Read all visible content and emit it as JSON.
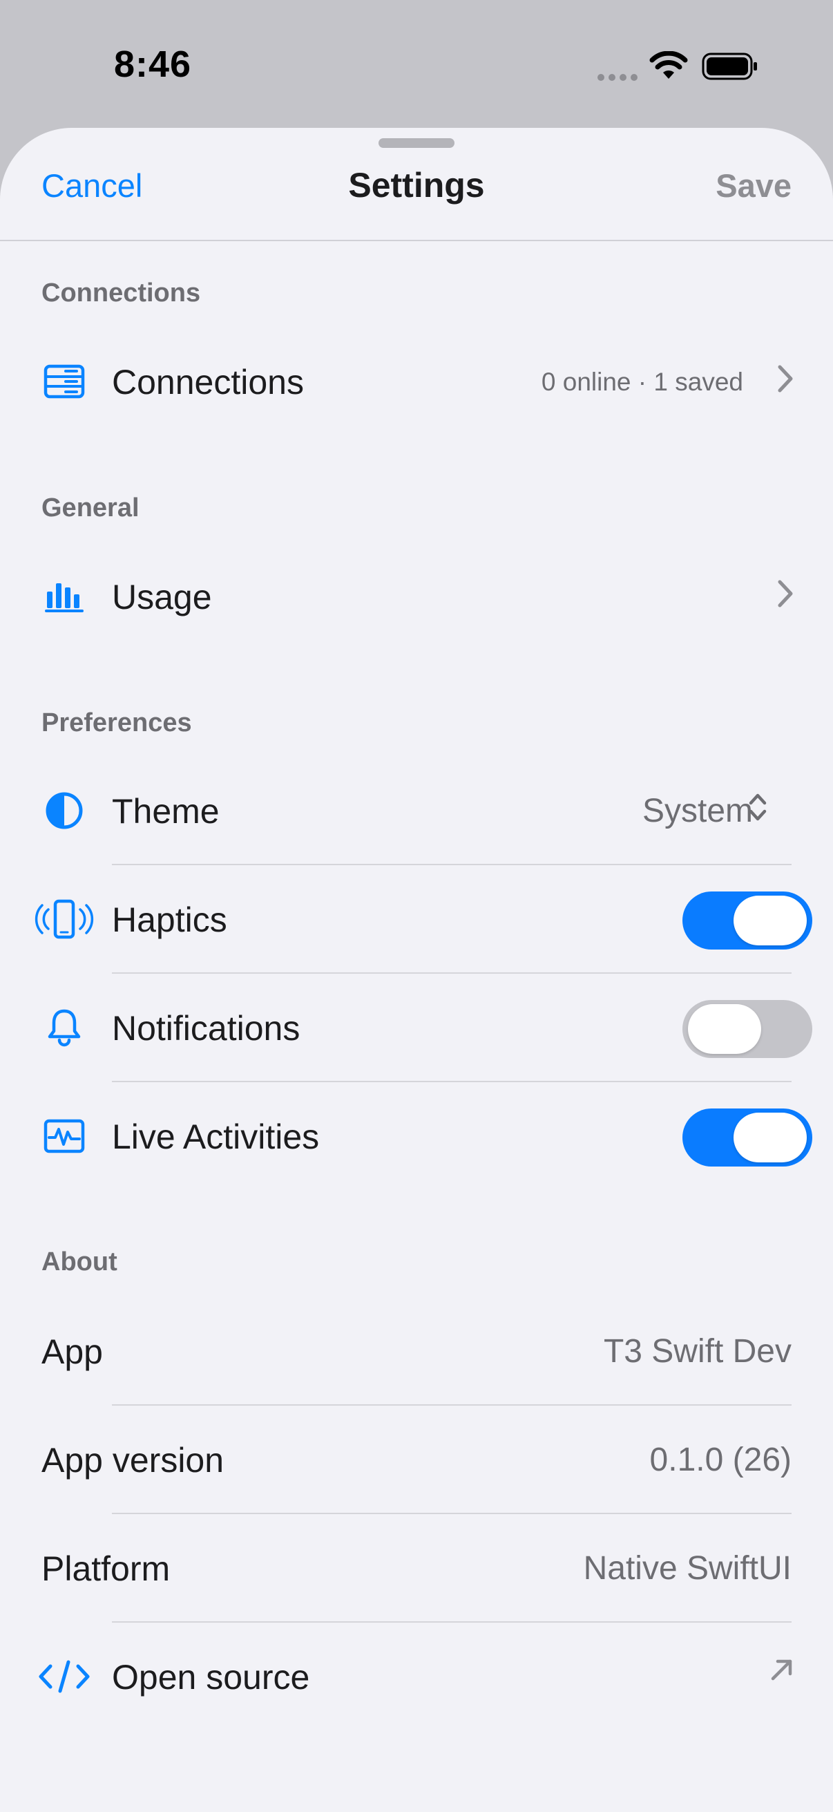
{
  "status_bar": {
    "time": "8:46",
    "icons": [
      "cellular-dots-icon",
      "wifi-icon",
      "battery-icon"
    ]
  },
  "nav": {
    "cancel_label": "Cancel",
    "title": "Settings",
    "save_label": "Save"
  },
  "sections": {
    "connections": {
      "header": "Connections",
      "row": {
        "icon": "server-icon",
        "label": "Connections",
        "detail": "0 online · 1 saved"
      }
    },
    "general": {
      "header": "General",
      "row": {
        "icon": "chart-bar-icon",
        "label": "Usage"
      }
    },
    "preferences": {
      "header": "Preferences",
      "theme": {
        "icon": "contrast-icon",
        "label": "Theme",
        "value": "System"
      },
      "haptics": {
        "icon": "phone-vibrate-icon",
        "label": "Haptics",
        "enabled": true
      },
      "notifications": {
        "icon": "bell-icon",
        "label": "Notifications",
        "enabled": false
      },
      "live_activities": {
        "icon": "waveform-icon",
        "label": "Live Activities",
        "enabled": true
      }
    },
    "about": {
      "header": "About",
      "app": {
        "label": "App",
        "value": "T3 Swift Dev"
      },
      "version": {
        "label": "App version",
        "value": "0.1.0 (26)"
      },
      "platform": {
        "label": "Platform",
        "value": "Native SwiftUI"
      },
      "open_source": {
        "icon": "code-icon",
        "label": "Open source"
      }
    }
  },
  "colors": {
    "accent": "#0a84ff",
    "toggle_on": "#0a7cff",
    "toggle_off": "#c4c4c9",
    "background": "#f2f2f7"
  }
}
